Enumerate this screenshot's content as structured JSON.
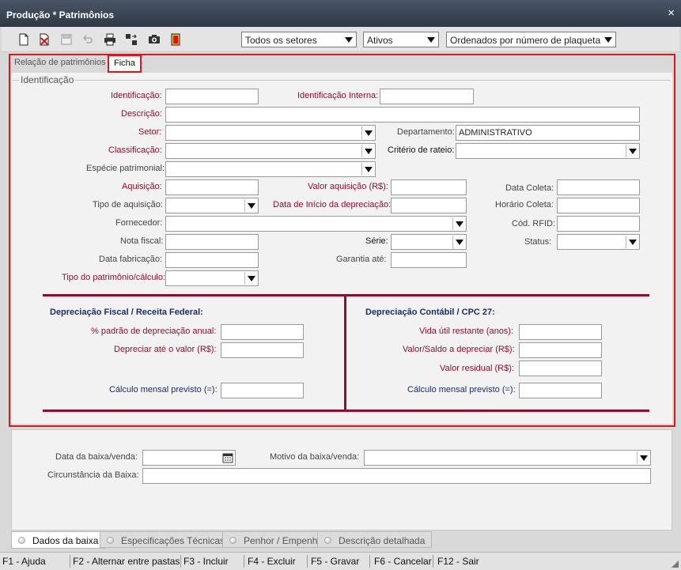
{
  "window": {
    "title": "Produção * Patrimônios",
    "close_icon": "×"
  },
  "toolbar": {
    "icons": [
      "new-document-icon",
      "delete-document-icon",
      "save-icon",
      "undo-icon",
      "print-icon",
      "export-icon",
      "camera-icon",
      "exit-icon"
    ],
    "sector_filter": "Todos os setores",
    "status_filter": "Ativos",
    "order_filter": "Ordenados por número de plaqueta con"
  },
  "tabs_top": {
    "list": "Relação de patrimônios",
    "ficha": "Ficha"
  },
  "identificacao": {
    "group_title": "Identificação",
    "identificacao": "Identificação:",
    "identificacao_interna": "Identificação Interna:",
    "descricao": "Descrição:",
    "setor": "Setor:",
    "departamento": "Departamento:",
    "departamento_value": "ADMINISTRATIVO",
    "classificacao": "Classificação:",
    "criterio_rateio": "Critério de rateio:",
    "especie": "Espécie patrimonial:",
    "aquisicao": "Aquisição:",
    "valor_aquisicao": "Valor aquisição (R$):",
    "data_coleta": "Data Coleta:",
    "tipo_aquisicao": "Tipo de aquisição:",
    "data_inicio_depreciacao": "Data de Início da depreciação:",
    "horario_coleta": "Horário Coleta:",
    "fornecedor": "Fornecedor:",
    "cod_rfid": "Cód. RFID:",
    "nota_fiscal": "Nota fiscal:",
    "serie": "Série:",
    "status": "Status:",
    "data_fabricacao": "Data fabricação:",
    "garantia": "Garantia até:",
    "tipo_patrimonio": "Tipo do patrimônio/cálculo:"
  },
  "depreciacao_fiscal": {
    "title": "Depreciação Fiscal / Receita Federal:",
    "percentual": "% padrão de depreciação anual:",
    "depreciar_ate": "Depreciar até o valor (R$):",
    "calculo_mensal": "Cálculo mensal previsto (=):"
  },
  "depreciacao_contabil": {
    "title": "Depreciação Contábil / CPC 27:",
    "vida_util": "Vida útil restante (anos):",
    "valor_saldo": "Valor/Saldo a depreciar (R$):",
    "valor_residual": "Valor residual (R$):",
    "calculo_mensal": "Cálculo mensal previsto (=):"
  },
  "baixa": {
    "data": "Data da baixa/venda:",
    "motivo": "Motivo da baixa/venda:",
    "circunstancia": "Circunstância da Baixa:"
  },
  "tabs_bottom": [
    "Dados da baixa",
    "Especificações Técnicas",
    "Penhor / Empenho",
    "Descrição detalhada"
  ],
  "statusbar": [
    "F1 - Ajuda",
    "F2 - Alternar entre pastas",
    "F3 - Incluir",
    "F4 - Excluir",
    "F5 - Gravar",
    "F6 - Cancelar",
    "F12 - Sair"
  ],
  "colors": {
    "accent_red": "#d7181f",
    "maroon": "#8b1030",
    "label_required": "#8b1030",
    "section_title": "#1b2d6b"
  }
}
